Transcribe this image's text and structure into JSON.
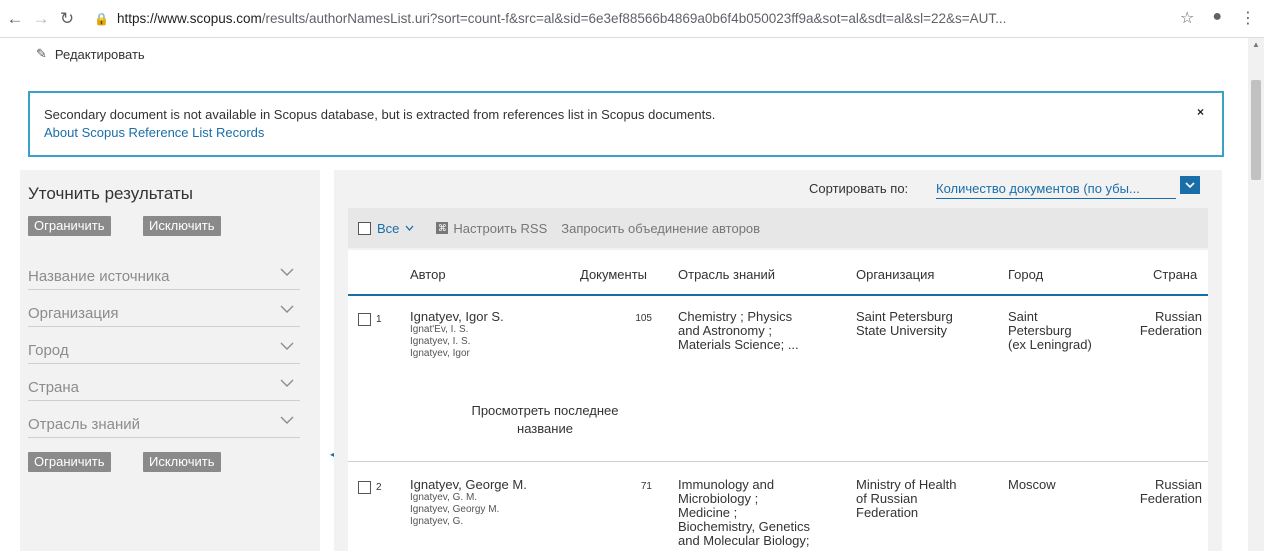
{
  "browser": {
    "url_host": "https://www.scopus.com",
    "url_rest": "/results/authorNamesList.uri?sort=count-f&src=al&sid=6e3ef88566b4869a0b6f4b050023ff9a&sot=al&sdt=al&sl=22&s=AUT..."
  },
  "edit_label": "Редактировать",
  "notice": {
    "text": "Secondary document is not available in Scopus database, but is extracted from references list in Scopus documents.",
    "link": "About Scopus Reference List Records",
    "close": "×"
  },
  "refine": {
    "title": "Уточнить результаты",
    "limit_label": "Ограничить",
    "exclude_label": "Исключить",
    "filters": [
      "Название источника",
      "Организация",
      "Город",
      "Страна",
      "Отрасль знаний"
    ]
  },
  "sort": {
    "label": "Сортировать по:",
    "value": "Количество документов (по убы..."
  },
  "toolbar": {
    "all_label": "Все",
    "rss_label": "Настроить RSS",
    "merge_label": "Запросить объединение авторов"
  },
  "table": {
    "headers": {
      "author": "Автор",
      "documents": "Документы",
      "subject": "Отрасль знаний",
      "organization": "Организация",
      "city": "Город",
      "country": "Страна"
    },
    "rows": [
      {
        "num": "1",
        "author": "Ignatyev, Igor S.",
        "variants": [
          "Ignat'Ev, I. S.",
          "Ignatyev, I. S.",
          "Ignatyev, Igor"
        ],
        "documents": "105",
        "subject": [
          "Chemistry ; Physics",
          "and Astronomy ;",
          "Materials Science; ..."
        ],
        "organization": [
          "Saint Petersburg",
          "State University"
        ],
        "city": [
          "Saint",
          "Petersburg",
          "(ex Leningrad)"
        ],
        "country": [
          "Russian",
          "Federation"
        ],
        "preview": [
          "Просмотреть последнее",
          "название"
        ]
      },
      {
        "num": "2",
        "author": "Ignatyev, George M.",
        "variants": [
          "Ignatyev, G. M.",
          "Ignatyev, Georgy M.",
          "Ignatyev, G."
        ],
        "documents": "71",
        "subject": [
          "Immunology and",
          "Microbiology ;",
          "Medicine ;",
          "Biochemistry, Genetics",
          "and Molecular Biology;"
        ],
        "organization": [
          "Ministry of Health",
          "of Russian",
          "Federation"
        ],
        "city": [
          "Moscow"
        ],
        "country": [
          "Russian",
          "Federation"
        ]
      }
    ]
  }
}
